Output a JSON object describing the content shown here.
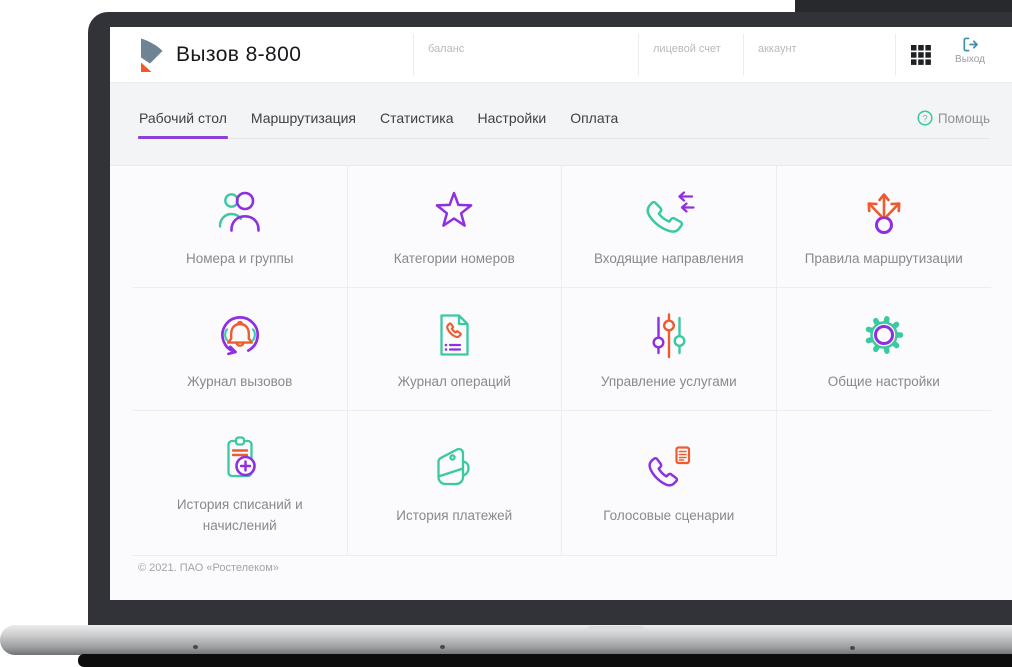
{
  "header": {
    "app_title": "Вызов 8-800",
    "fields": [
      {
        "label": "баланс"
      },
      {
        "label": "лицевой счет"
      },
      {
        "label": "аккаунт"
      }
    ],
    "apps_grid_icon": "apps-grid-icon",
    "exit_label": "Выход"
  },
  "nav": {
    "tabs": [
      {
        "label": "Рабочий стол",
        "active": true
      },
      {
        "label": "Маршрутизация",
        "active": false
      },
      {
        "label": "Статистика",
        "active": false
      },
      {
        "label": "Настройки",
        "active": false
      },
      {
        "label": "Оплата",
        "active": false
      }
    ],
    "help_label": "Помощь"
  },
  "tiles": [
    {
      "label": "Номера и группы",
      "icon": "people-icon"
    },
    {
      "label": "Категории номеров",
      "icon": "star-icon"
    },
    {
      "label": "Входящие направления",
      "icon": "phone-incoming-icon"
    },
    {
      "label": "Правила маршрутизации",
      "icon": "route-branch-icon"
    },
    {
      "label": "Журнал вызовов",
      "icon": "call-log-icon"
    },
    {
      "label": "Журнал операций",
      "icon": "operations-log-icon"
    },
    {
      "label": "Управление услугами",
      "icon": "sliders-icon"
    },
    {
      "label": "Общие настройки",
      "icon": "gear-icon"
    },
    {
      "label": "История списаний и начислений",
      "icon": "clipboard-plus-icon"
    },
    {
      "label": "История платежей",
      "icon": "wallet-icon"
    },
    {
      "label": "Голосовые сценарии",
      "icon": "voice-script-icon"
    }
  ],
  "footer": {
    "copyright": "© 2021. ПАО «Ростелеком»"
  },
  "colors": {
    "accent_purple": "#8e2fe0",
    "accent_green": "#3cc9a2",
    "accent_orange": "#ec5c2f",
    "tab_underline": "#8e3fd8",
    "exit_teal": "#3f93a3",
    "logo_gray": "#6e8494",
    "logo_orange": "#f15a24"
  }
}
